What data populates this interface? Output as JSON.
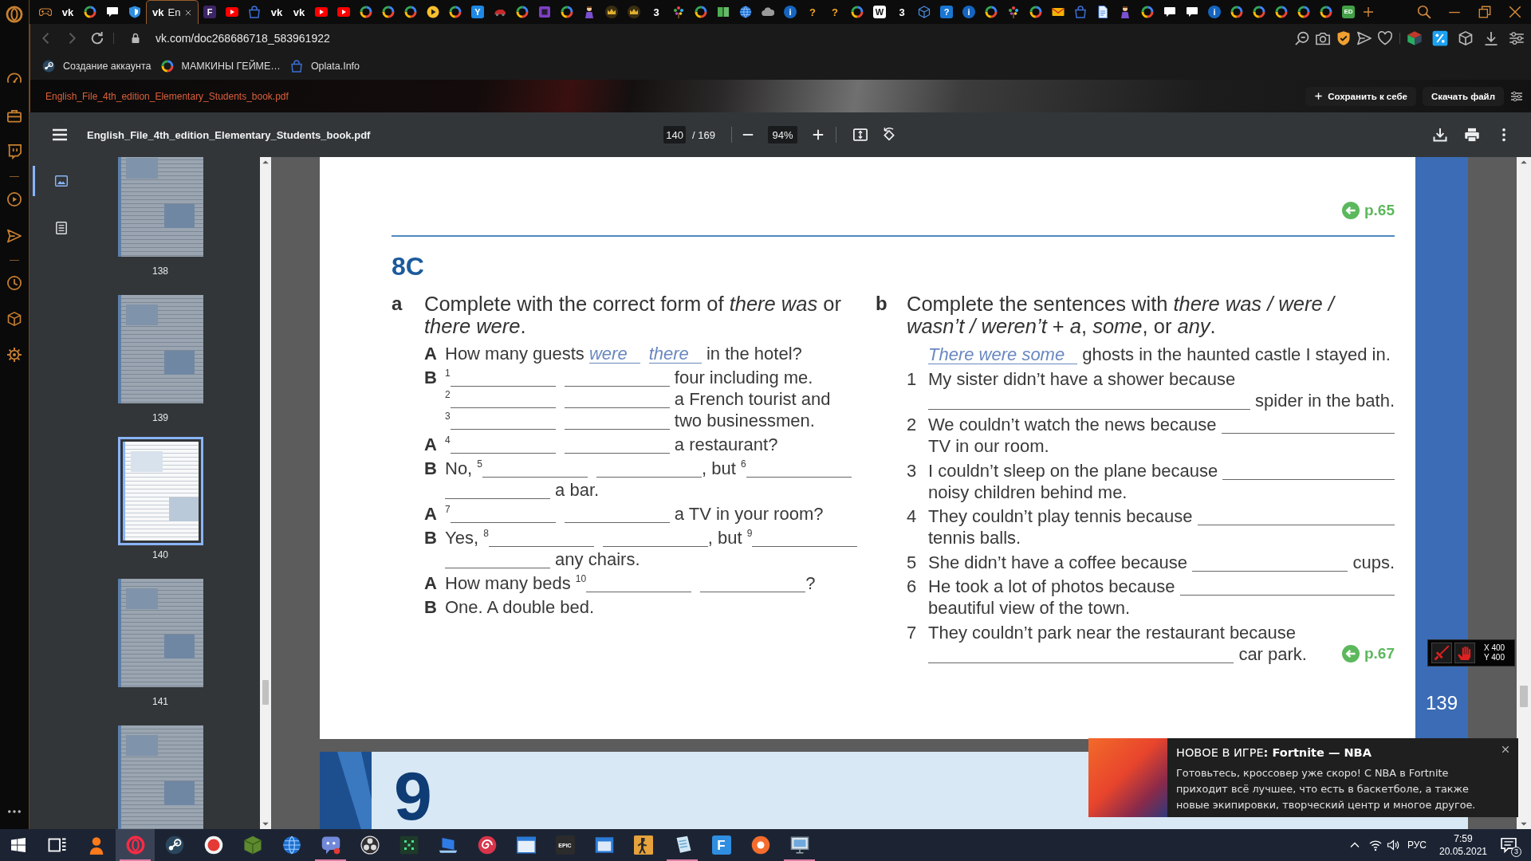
{
  "browser": {
    "tabs": [
      {
        "kind": "gamepad",
        "selected": false
      },
      {
        "kind": "mark",
        "glyph": "vk",
        "color": "#ffffff",
        "selected": false
      },
      {
        "kind": "ring",
        "selected": false
      },
      {
        "kind": "chat",
        "selected": false
      },
      {
        "kind": "shield",
        "selected": false
      },
      {
        "kind": "mark",
        "glyph": "vk",
        "color": "#ffffff",
        "label": "En",
        "selected": true
      },
      {
        "kind": "letter",
        "glyph": "F",
        "color": "#3d2466",
        "selected": false
      },
      {
        "kind": "play",
        "selected": false
      },
      {
        "kind": "bag",
        "selected": false
      },
      {
        "kind": "mark",
        "glyph": "vk",
        "color": "#ffffff",
        "selected": false
      },
      {
        "kind": "mark",
        "glyph": "vk",
        "color": "#ffffff",
        "selected": false
      },
      {
        "kind": "play",
        "selected": false
      },
      {
        "kind": "play",
        "selected": false
      },
      {
        "kind": "ring",
        "selected": false
      },
      {
        "kind": "ring",
        "selected": false
      },
      {
        "kind": "ring",
        "selected": false
      },
      {
        "kind": "playdisc",
        "selected": false
      },
      {
        "kind": "ring",
        "selected": false
      },
      {
        "kind": "letter",
        "glyph": "Y",
        "color": "#1e88e5",
        "selected": false
      },
      {
        "kind": "car",
        "selected": false
      },
      {
        "kind": "ring",
        "selected": false
      },
      {
        "kind": "square",
        "selected": false
      },
      {
        "kind": "ring",
        "selected": false
      },
      {
        "kind": "figure",
        "selected": false
      },
      {
        "kind": "crown",
        "selected": false
      },
      {
        "kind": "crown",
        "selected": false
      },
      {
        "kind": "mark",
        "glyph": "3",
        "color": "#ffffff",
        "selected": false
      },
      {
        "kind": "tree",
        "selected": false
      },
      {
        "kind": "ring",
        "selected": false
      },
      {
        "kind": "book",
        "selected": false
      },
      {
        "kind": "globe",
        "selected": false
      },
      {
        "kind": "cloud",
        "selected": false
      },
      {
        "kind": "disc",
        "glyph": "i",
        "color": "#1565c0",
        "selected": false
      },
      {
        "kind": "mark",
        "glyph": "?",
        "color": "#f5a623",
        "selected": false
      },
      {
        "kind": "mark",
        "glyph": "?",
        "color": "#f5a623",
        "selected": false
      },
      {
        "kind": "ring",
        "selected": false
      },
      {
        "kind": "letter",
        "glyph": "W",
        "color": "#ffffff",
        "selected": false
      },
      {
        "kind": "mark",
        "glyph": "3",
        "color": "#ffffff",
        "selected": false
      },
      {
        "kind": "box",
        "selected": false
      },
      {
        "kind": "letter",
        "glyph": "?",
        "color": "#1976d2",
        "selected": false
      },
      {
        "kind": "disc",
        "glyph": "i",
        "color": "#1565c0",
        "selected": false
      },
      {
        "kind": "ring",
        "selected": false
      },
      {
        "kind": "tree",
        "selected": false
      },
      {
        "kind": "ring",
        "selected": false
      },
      {
        "kind": "mail",
        "selected": false
      },
      {
        "kind": "bag",
        "selected": false
      },
      {
        "kind": "doc",
        "selected": false
      },
      {
        "kind": "figure",
        "selected": false
      },
      {
        "kind": "ring",
        "selected": false
      },
      {
        "kind": "chat",
        "selected": false
      },
      {
        "kind": "chat",
        "selected": false
      },
      {
        "kind": "disc",
        "glyph": "i",
        "color": "#1565c0",
        "selected": false
      },
      {
        "kind": "ring",
        "selected": false
      },
      {
        "kind": "ring",
        "selected": false
      },
      {
        "kind": "ring",
        "selected": false
      },
      {
        "kind": "ring",
        "selected": false
      },
      {
        "kind": "ring",
        "selected": false
      },
      {
        "kind": "letter",
        "glyph": "ED",
        "color": "#43a047",
        "selected": false
      }
    ],
    "address_bar": {
      "url": "vk.com/doc268686718_583961922"
    },
    "bookmarks": [
      {
        "kind": "knob",
        "label": "Создание аккаунта"
      },
      {
        "kind": "ring",
        "label": "МАМКИНЫ ГЕЙМЕ…"
      },
      {
        "kind": "bag",
        "label": "Oplata.Info"
      }
    ]
  },
  "document": {
    "file_name": "English_File_4th_edition_Elementary_Students_book.pdf",
    "actions": [
      {
        "kind": "add",
        "label": "Сохранить к себе"
      },
      {
        "kind": "plain",
        "label": "Скачать файл"
      }
    ]
  },
  "pdf_viewer": {
    "title": "English_File_4th_edition_Elementary_Students_book.pdf",
    "page_input": "140",
    "page_count": "/ 169",
    "zoom": "94%",
    "panel_views": [
      {
        "kind": "thumbnails",
        "selected": true
      },
      {
        "kind": "outline",
        "selected": false
      }
    ],
    "thumbnails": [
      {
        "label": "138",
        "selected": false
      },
      {
        "label": "139",
        "selected": false
      },
      {
        "label": "140",
        "selected": true
      },
      {
        "label": "141",
        "selected": false
      },
      {
        "selected": false
      }
    ],
    "page": {
      "reference_top": "p.65",
      "section": "8C",
      "exercises": [
        {
          "letter": "a",
          "instruction": "Complete with the correct form of *there was* or *there were*.",
          "lines": [
            {
              "speaker": "A",
              "parts": [
                {
                  "kind": "text",
                  "text": "How many guests "
                },
                {
                  "kind": "blank",
                  "value": "were"
                },
                {
                  "kind": "blank",
                  "value": "there"
                },
                {
                  "kind": "text",
                  "text": " in the hotel?"
                }
              ]
            },
            {
              "speaker": "B",
              "parts": [
                {
                  "kind": "number",
                  "text": "1"
                },
                {
                  "kind": "blank"
                },
                {
                  "kind": "blank"
                },
                {
                  "kind": "text",
                  "text": " four including me."
                }
              ]
            },
            {
              "parts": [
                {
                  "kind": "number",
                  "text": "2"
                },
                {
                  "kind": "blank"
                },
                {
                  "kind": "blank"
                },
                {
                  "kind": "text",
                  "text": " a French tourist and"
                }
              ]
            },
            {
              "parts": [
                {
                  "kind": "number",
                  "text": "3"
                },
                {
                  "kind": "blank"
                },
                {
                  "kind": "blank"
                },
                {
                  "kind": "text",
                  "text": " two businessmen."
                }
              ]
            },
            {
              "speaker": "A",
              "parts": [
                {
                  "kind": "number",
                  "text": "4"
                },
                {
                  "kind": "blank"
                },
                {
                  "kind": "blank"
                },
                {
                  "kind": "text",
                  "text": " a restaurant?"
                }
              ]
            },
            {
              "speaker": "B",
              "parts": [
                {
                  "kind": "text",
                  "text": "No, "
                },
                {
                  "kind": "number",
                  "text": "5"
                },
                {
                  "kind": "blank"
                },
                {
                  "kind": "blank"
                },
                {
                  "kind": "text",
                  "text": ", but "
                },
                {
                  "kind": "number",
                  "text": "6"
                },
                {
                  "kind": "blank"
                }
              ]
            },
            {
              "parts": [
                {
                  "kind": "blank"
                },
                {
                  "kind": "text",
                  "text": " a bar."
                }
              ]
            },
            {
              "speaker": "A",
              "parts": [
                {
                  "kind": "number",
                  "text": "7"
                },
                {
                  "kind": "blank"
                },
                {
                  "kind": "blank"
                },
                {
                  "kind": "text",
                  "text": " a TV in your room?"
                }
              ]
            },
            {
              "speaker": "B",
              "parts": [
                {
                  "kind": "text",
                  "text": "Yes, "
                },
                {
                  "kind": "number",
                  "text": "8"
                },
                {
                  "kind": "blank"
                },
                {
                  "kind": "blank"
                },
                {
                  "kind": "text",
                  "text": ", but "
                },
                {
                  "kind": "number",
                  "text": "9"
                },
                {
                  "kind": "blank"
                }
              ]
            },
            {
              "parts": [
                {
                  "kind": "blank"
                },
                {
                  "kind": "text",
                  "text": " any chairs."
                }
              ]
            },
            {
              "speaker": "A",
              "parts": [
                {
                  "kind": "text",
                  "text": "How many beds "
                },
                {
                  "kind": "number",
                  "text": "10"
                },
                {
                  "kind": "blank"
                },
                {
                  "kind": "blank"
                },
                {
                  "kind": "text",
                  "text": "?"
                }
              ]
            },
            {
              "speaker": "B",
              "parts": [
                {
                  "kind": "text",
                  "text": "One. A double bed."
                }
              ]
            }
          ]
        },
        {
          "letter": "b",
          "instruction": "Complete the sentences with *there was / were / wasn’t / weren’t* + *a*, *some*, or *any*.",
          "example": [
            {
              "kind": "blank",
              "value": "There were some"
            },
            {
              "kind": "text",
              "text": " ghosts in the haunted castle I stayed in."
            }
          ],
          "items": [
            {
              "number": "1",
              "lines": [
                [
                  {
                    "kind": "text",
                    "text": "My sister didn’t have a shower because"
                  }
                ],
                [
                  {
                    "kind": "blank"
                  },
                  {
                    "kind": "text",
                    "text": " spider in the bath."
                  }
                ]
              ]
            },
            {
              "number": "2",
              "lines": [
                [
                  {
                    "kind": "text",
                    "text": "We couldn’t watch the news because "
                  },
                  {
                    "kind": "blank"
                  }
                ],
                [
                  {
                    "kind": "text",
                    "text": "TV in our room."
                  }
                ]
              ]
            },
            {
              "number": "3",
              "lines": [
                [
                  {
                    "kind": "text",
                    "text": "I couldn’t sleep on the plane because "
                  },
                  {
                    "kind": "blank"
                  }
                ],
                [
                  {
                    "kind": "text",
                    "text": "noisy children behind me."
                  }
                ]
              ]
            },
            {
              "number": "4",
              "lines": [
                [
                  {
                    "kind": "text",
                    "text": "They couldn’t play tennis because "
                  },
                  {
                    "kind": "blank"
                  }
                ],
                [
                  {
                    "kind": "text",
                    "text": "tennis balls."
                  }
                ]
              ]
            },
            {
              "number": "5",
              "lines": [
                [
                  {
                    "kind": "text",
                    "text": "She didn’t have a coffee because "
                  },
                  {
                    "kind": "blank"
                  },
                  {
                    "kind": "text",
                    "text": " cups."
                  }
                ]
              ]
            },
            {
              "number": "6",
              "lines": [
                [
                  {
                    "kind": "text",
                    "text": "He took a lot of photos because "
                  },
                  {
                    "kind": "blank"
                  }
                ],
                [
                  {
                    "kind": "text",
                    "text": "beautiful view of the town."
                  }
                ]
              ]
            },
            {
              "number": "7",
              "lines": [
                [
                  {
                    "kind": "text",
                    "text": "They couldn’t park near the restaurant because"
                  }
                ],
                [
                  {
                    "kind": "blank"
                  },
                  {
                    "kind": "text",
                    "text": " car park."
                  }
                ]
              ]
            }
          ],
          "reference": "p.67"
        }
      ],
      "page_number": "139"
    },
    "next_page": {
      "heading": "9"
    }
  },
  "overlay_widget": {
    "lines": [
      "X 400",
      "Y 400"
    ]
  },
  "notification": {
    "title": "НОВОЕ В ИГРЕ**: Fortnite — NBA**",
    "body": "Готовьтесь, кроссовер уже скоро! С NBA в Fortnite приходит всё лучшее, что есть в баскетболе, а также новые экипировки, творческий центр и многое другое."
  },
  "taskbar": {
    "apps": [
      {
        "kind": "start",
        "selected": false,
        "running": false
      },
      {
        "kind": "taskview",
        "selected": false,
        "running": false
      },
      {
        "kind": "person",
        "selected": false,
        "running": false
      },
      {
        "kind": "oring",
        "selected": true,
        "running": true
      },
      {
        "kind": "knob",
        "selected": false,
        "running": false
      },
      {
        "kind": "record",
        "selected": false,
        "running": false
      },
      {
        "kind": "block",
        "selected": false,
        "running": false
      },
      {
        "kind": "globe",
        "selected": false,
        "running": false
      },
      {
        "kind": "gamechat",
        "selected": false,
        "running": true
      },
      {
        "kind": "aperture",
        "selected": false,
        "running": false
      },
      {
        "kind": "grid",
        "selected": false,
        "running": false
      },
      {
        "kind": "laptop",
        "selected": false,
        "running": false
      },
      {
        "kind": "spiral",
        "selected": false,
        "running": false
      },
      {
        "kind": "window",
        "selected": false,
        "running": false
      },
      {
        "kind": "letter",
        "glyph": "EPIC",
        "color": "#2b2b2b",
        "selected": false,
        "running": false
      },
      {
        "kind": "bwindow",
        "selected": false,
        "running": false
      },
      {
        "kind": "soldier",
        "selected": false,
        "running": false
      },
      {
        "kind": "paper",
        "selected": false,
        "running": true
      },
      {
        "kind": "letter",
        "glyph": "F",
        "color": "#2f8ee0",
        "selected": false,
        "running": false
      },
      {
        "kind": "odisc",
        "selected": false,
        "running": false
      },
      {
        "kind": "computer",
        "selected": false,
        "running": true
      }
    ],
    "tray": {
      "language": "РУС",
      "time": "7:59",
      "date": "20.05.2021",
      "notification_count": "3"
    }
  }
}
